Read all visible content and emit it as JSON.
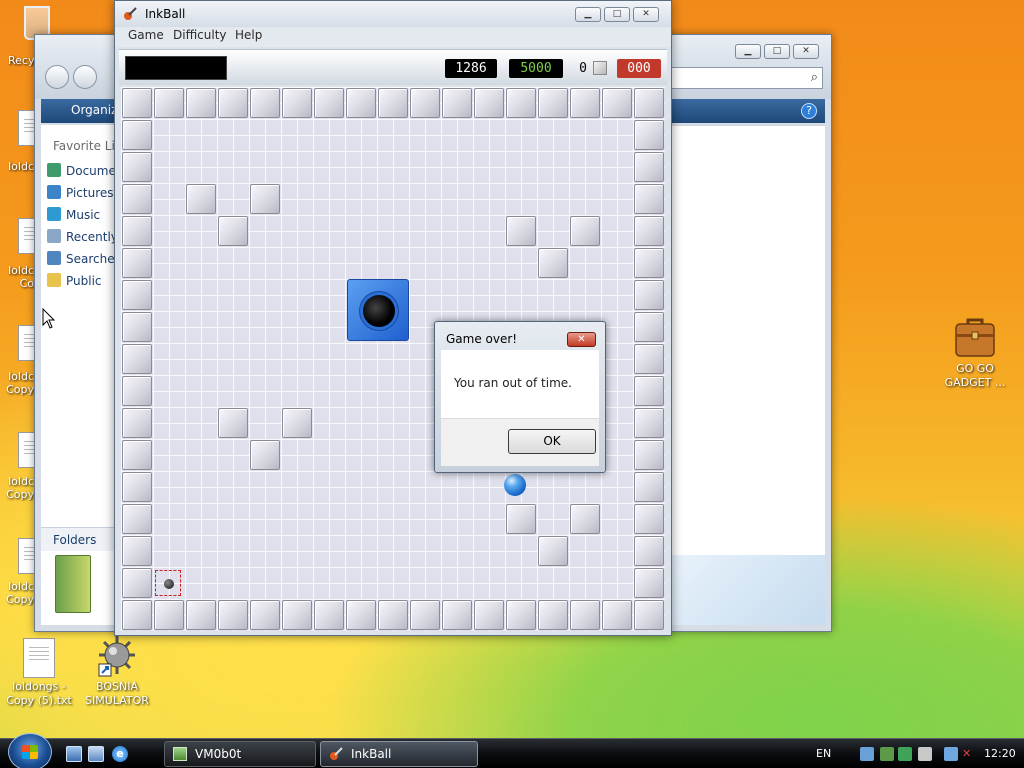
{
  "desktop": {
    "left_icons": [
      {
        "label": "Recy"
      },
      {
        "label": "loldc"
      },
      {
        "label": "loldc Co"
      },
      {
        "label": "loldc Copy"
      },
      {
        "label": "loldc Copy"
      },
      {
        "label": "loldc Copy"
      }
    ],
    "bottom_icons": [
      {
        "label": "loldongs - Copy (5).txt",
        "icon": "text-file-icon"
      },
      {
        "label": "BOSNIA SIMULATOR",
        "icon": "spiked-mine-shortcut-icon"
      }
    ],
    "right_icon": {
      "label": "GO GO GADGET ...",
      "icon": "briefcase-icon"
    }
  },
  "explorer": {
    "toolbar_label": "Organiz",
    "favorite_links_label": "Favorite Lin",
    "nav_links": [
      "Docume",
      "Pictures",
      "Music",
      "Recently",
      "Searche",
      "Public"
    ],
    "folders_label": "Folders"
  },
  "inkball": {
    "title": "InkBall",
    "menu": [
      "Game",
      "Difficulty",
      "Help"
    ],
    "counters": {
      "time": "1286",
      "score": "5000",
      "balls_caught": "0",
      "missed": "000"
    },
    "colors": {
      "hole": "#2a6fd6",
      "ball": "#1765c8",
      "missed_counter": "#c0392b",
      "score_counter": "#7cd048"
    }
  },
  "dialog": {
    "title": "Game over!",
    "message": "You ran out of time.",
    "ok_label": "OK"
  },
  "taskbar": {
    "tasks": [
      "VM0b0t",
      "InkBall"
    ],
    "language": "EN",
    "clock": "12:20"
  }
}
